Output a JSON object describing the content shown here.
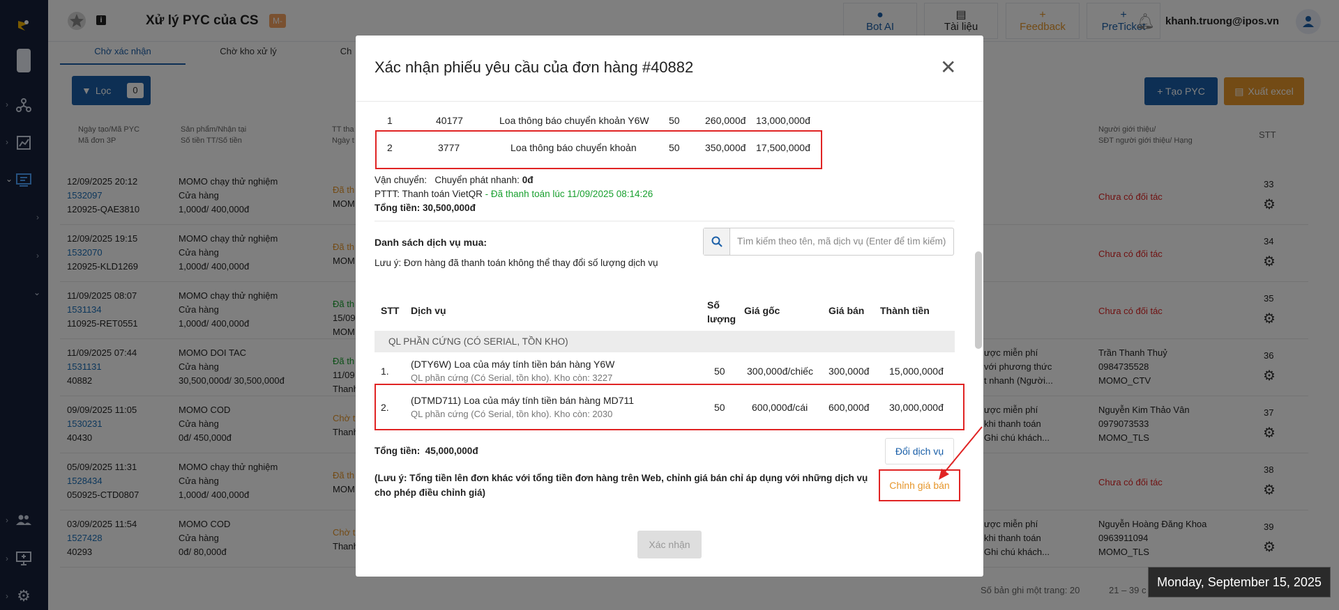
{
  "header": {
    "title": "Xử lý PYC của CS",
    "badge": "M-",
    "buttons": [
      {
        "icon": "chat-icon",
        "label": "Bot AI"
      },
      {
        "icon": "book-icon",
        "label": "Tài liệu"
      },
      {
        "icon": "plus-icon",
        "label": "Feedback"
      },
      {
        "icon": "plus-icon",
        "label": "PreTicket"
      }
    ],
    "user_email": "khanh.truong@ipos.vn"
  },
  "tabs": [
    "Chờ xác nhận",
    "Chờ kho xử lý",
    "Ch"
  ],
  "toolbar": {
    "filter_label": "Lọc",
    "filter_count": "0",
    "create_label": "+ Tạo PYC",
    "export_label": "Xuất excel"
  },
  "table_headers": {
    "col1": [
      "Ngày tạo/Mã PYC",
      "Mã đơn 3P"
    ],
    "col2": [
      "Sản phẩm/Nhận tại",
      "Số tiền TT/Số tiền"
    ],
    "col3": [
      "TT tha",
      "Ngày t"
    ],
    "col_ref": [
      "Người giới thiệu/",
      "SĐT người giới thiệu/ Hạng"
    ],
    "col_stt": "STT"
  },
  "rows": [
    {
      "date": "12/09/2025 20:12",
      "code": "1532097",
      "ext": "120925-QAE3810",
      "product": "MOMO chạy thử nghiệm",
      "receive": "Cửa hàng",
      "amount": "1,000đ/ 400,000đ",
      "status": "Đã th",
      "status_color": "orange",
      "status2": "MOM",
      "note": "",
      "partner": "Chưa có đối tác",
      "ref": [],
      "stt": "33"
    },
    {
      "date": "12/09/2025 19:15",
      "code": "1532070",
      "ext": "120925-KLD1269",
      "product": "MOMO chạy thử nghiệm",
      "receive": "Cửa hàng",
      "amount": "1,000đ/ 400,000đ",
      "status": "Đã th",
      "status_color": "orange",
      "status2": "MOM",
      "note": "",
      "partner": "Chưa có đối tác",
      "ref": [],
      "stt": "34"
    },
    {
      "date": "11/09/2025 08:07",
      "code": "1531134",
      "ext": "110925-RET0551",
      "product": "MOMO chạy thử nghiệm",
      "receive": "Cửa hàng",
      "amount": "1,000đ/ 400,000đ",
      "status": "Đã th",
      "status_color": "green",
      "status2": "15/09",
      "status3": "MOM",
      "partner": "Chưa có đối tác",
      "ref": [],
      "stt": "35"
    },
    {
      "date": "11/09/2025 07:44",
      "code": "1531131",
      "ext": "40882",
      "product": "MOMO DOI TAC",
      "receive": "Cửa hàng",
      "amount": "30,500,000đ/ 30,500,000đ",
      "status": "Đã th",
      "status_color": "green",
      "status2": "11/09",
      "status3": "Thanh",
      "note": [
        "ược miễn phí",
        "với phương thức",
        "t nhanh (Người..."
      ],
      "partner": "",
      "ref": [
        "Trần Thanh Thuỷ",
        "0984735528",
        "MOMO_CTV"
      ],
      "stt": "36"
    },
    {
      "date": "09/09/2025 11:05",
      "code": "1530231",
      "ext": "40430",
      "product": "MOMO COD",
      "receive": "Cửa hàng",
      "amount": "0đ/ 450,000đ",
      "status": "Chờ t",
      "status_color": "orange",
      "status2": "Thanh",
      "note": [
        "ược miễn phí",
        "khi thanh toán",
        "Ghi chú khách..."
      ],
      "partner": "",
      "ref": [
        "Nguyễn Kim Thảo Vân",
        "0979073533",
        "MOMO_TLS"
      ],
      "stt": "37"
    },
    {
      "date": "05/09/2025 11:31",
      "code": "1528434",
      "ext": "050925-CTD0807",
      "product": "MOMO chạy thử nghiệm",
      "receive": "Cửa hàng",
      "amount": "1,000đ/ 400,000đ",
      "status": "Đã th",
      "status_color": "orange",
      "status2": "MOM",
      "note": "",
      "partner": "Chưa có đối tác",
      "ref": [],
      "stt": "38"
    },
    {
      "date": "03/09/2025 11:54",
      "code": "1527428",
      "ext": "40293",
      "product": "MOMO COD",
      "receive": "Cửa hàng",
      "amount": "0đ/ 80,000đ",
      "status": "Chờ t",
      "status_color": "orange",
      "status2": "Thanh",
      "note": [
        "ược miễn phí",
        "khi thanh toán",
        "Ghi chú khách..."
      ],
      "partner": "",
      "ref": [
        "Nguyễn Hoàng Đăng Khoa",
        "0963911094",
        "MOMO_TLS"
      ],
      "stt": "39"
    }
  ],
  "footer": {
    "page_size": "Số bản ghi một trang: 20",
    "range": "21 – 39 c"
  },
  "date_flag": "Monday, September 15, 2025",
  "modal": {
    "title": "Xác nhận phiếu yêu cầu của đơn hàng #40882",
    "order_items": [
      {
        "stt": "1",
        "code": "40177",
        "name": "Loa thông báo chuyển khoản Y6W",
        "qty": "50",
        "price": "260,000đ",
        "total": "13,000,000đ"
      },
      {
        "stt": "2",
        "code": "3777",
        "name": "Loa thông báo chuyển khoản",
        "qty": "50",
        "price": "350,000đ",
        "total": "17,500,000đ"
      }
    ],
    "shipping_label": "Vận chuyển:",
    "shipping_value": "Chuyển phát nhanh:",
    "shipping_fee": "0đ",
    "payment_label": "PTTT: Thanh toán VietQR",
    "payment_status": " - Đã thanh toán lúc 11/09/2025 08:14:26",
    "total_label": "Tổng tiền:",
    "total_value": "30,500,000đ",
    "services_label": "Danh sách dịch vụ mua:",
    "services_note": "Lưu ý: Đơn hàng đã thanh toán không thể thay đổi số lượng dịch vụ",
    "search_placeholder": "Tìm kiếm theo tên, mã dịch vụ (Enter để tìm kiếm)",
    "svc_headers": {
      "stt": "STT",
      "service": "Dịch vụ",
      "qty1": "Số",
      "qty2": "lượng",
      "base": "Giá gốc",
      "sell": "Giá bán",
      "total": "Thành tiền"
    },
    "group": "QL PHẦN CỨNG (CÓ SERIAL, TỒN KHO)",
    "services": [
      {
        "stt": "1.",
        "name": "(DTY6W) Loa của máy tính tiền bán hàng Y6W",
        "sub": "QL phần cứng (Có Serial, tồn kho). Kho còn: 3227",
        "qty": "50",
        "base": "300,000đ/chiếc",
        "sell": "300,000đ",
        "total": "15,000,000đ"
      },
      {
        "stt": "2.",
        "name": "(DTMD711) Loa của máy tính tiền bán hàng MD711",
        "sub": "QL phần cứng (Có Serial, tồn kho). Kho còn: 2030",
        "qty": "50",
        "base": "600,000đ/cái",
        "sell": "600,000đ",
        "total": "30,000,000đ"
      }
    ],
    "svc_total_label": "Tổng tiền:",
    "svc_total_value": "45,000,000đ",
    "change_service": "Đổi dịch vụ",
    "warning": "(Lưu ý: Tổng tiền lên đơn khác với tổng tiền đơn hàng trên Web, chỉnh giá bán chỉ áp dụng với những dịch vụ cho phép điều chỉnh giá)",
    "adjust_price": "Chỉnh giá bán",
    "confirm": "Xác nhận"
  }
}
